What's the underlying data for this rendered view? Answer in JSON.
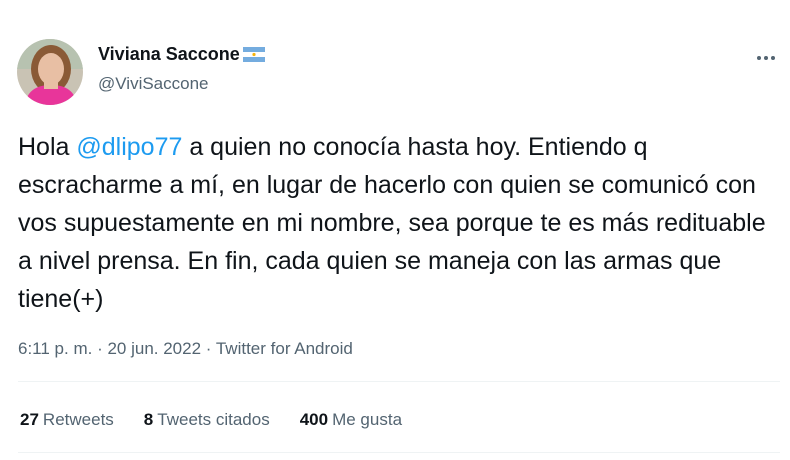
{
  "author": {
    "display_name": "Viviana Saccone",
    "handle": "@ViviSaccone",
    "flag_icon": "argentina-flag-icon"
  },
  "tweet": {
    "text_before": "Hola ",
    "mention": "@dlipo77",
    "text_after": " a quien no conocía hasta hoy. Entiendo q escracharme a mí, en lugar de hacerlo con quien se comunicó con vos supuestamente en mi nombre, sea porque te es más redituable a nivel prensa. En fin, cada quien se maneja con las armas que tiene(+)"
  },
  "meta": {
    "time": "6:11 p. m.",
    "separator": " · ",
    "date": "20 jun. 2022",
    "source": "Twitter for Android"
  },
  "stats": [
    {
      "num": "27",
      "label": "Retweets"
    },
    {
      "num": "8",
      "label": "Tweets citados"
    },
    {
      "num": "400",
      "label": "Me gusta"
    }
  ],
  "colors": {
    "accent": "#1d9bf0",
    "secondary_text": "#536471",
    "primary_text": "#0f1419",
    "divider": "#eff3f4"
  }
}
